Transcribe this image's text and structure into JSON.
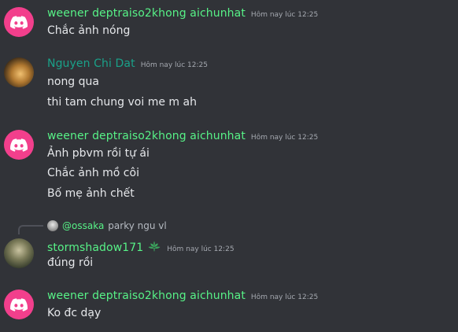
{
  "messages": [
    {
      "author": "weener deptraiso2khong aichunhat",
      "time": "Hôm nay lúc 12:25",
      "avatar": "discord-logo-icon",
      "lines": [
        "Chắc ảnh nóng"
      ]
    },
    {
      "author": "Nguyen Chi Dat",
      "time": "Hôm nay lúc 12:25",
      "avatar": "user-photo",
      "lines": [
        "nong qua",
        "thi tam chung voi me m ah"
      ]
    },
    {
      "author": "weener deptraiso2khong aichunhat",
      "time": "Hôm nay lúc 12:25",
      "avatar": "discord-logo-icon",
      "lines": [
        "Ảnh pbvm rồi tự ái",
        "Chắc ảnh mồ côi",
        "Bố mẹ ảnh chết"
      ]
    },
    {
      "author": "stormshadow171",
      "time": "Hôm nay lúc 12:25",
      "avatar": "user-photo",
      "badge": "leaf-badge-icon",
      "reply": {
        "user": "@ossaka",
        "text": "parky ngu vl"
      },
      "lines": [
        "đúng rồi"
      ]
    },
    {
      "author": "weener deptraiso2khong aichunhat",
      "time": "Hôm nay lúc 12:25",
      "avatar": "discord-logo-icon",
      "lines": [
        "Ko đc dạy"
      ]
    }
  ],
  "colors": {
    "background": "#313338",
    "username_green": "#57f287",
    "username_teal": "#1aa189",
    "discord_avatar": "#f23f8c",
    "text": "#e5e7ea",
    "timestamp": "#a5a9b0"
  }
}
